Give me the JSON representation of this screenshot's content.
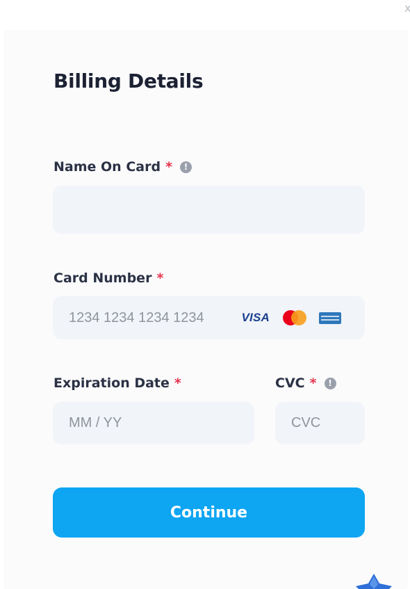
{
  "form": {
    "title": "Billing Details",
    "name_on_card": {
      "label": "Name On Card",
      "required_mark": "*",
      "info_glyph": "!",
      "value": "",
      "placeholder": ""
    },
    "card_number": {
      "label": "Card Number",
      "required_mark": "*",
      "value": "",
      "placeholder": "1234 1234 1234 1234",
      "brands": {
        "visa": "VISA",
        "mastercard_icon": "mastercard-icon",
        "amex_icon": "amex-icon"
      }
    },
    "expiration": {
      "label": "Expiration Date",
      "required_mark": "*",
      "value": "",
      "placeholder": "MM / YY"
    },
    "cvc": {
      "label": "CVC",
      "required_mark": "*",
      "info_glyph": "!",
      "value": "",
      "placeholder": "CVC"
    },
    "continue_label": "Continue"
  },
  "window": {
    "close_glyph": "x"
  },
  "colors": {
    "accent": "#0ea5f2",
    "required": "#e5344c",
    "field_bg": "#f1f4f8",
    "title": "#1c2233"
  }
}
